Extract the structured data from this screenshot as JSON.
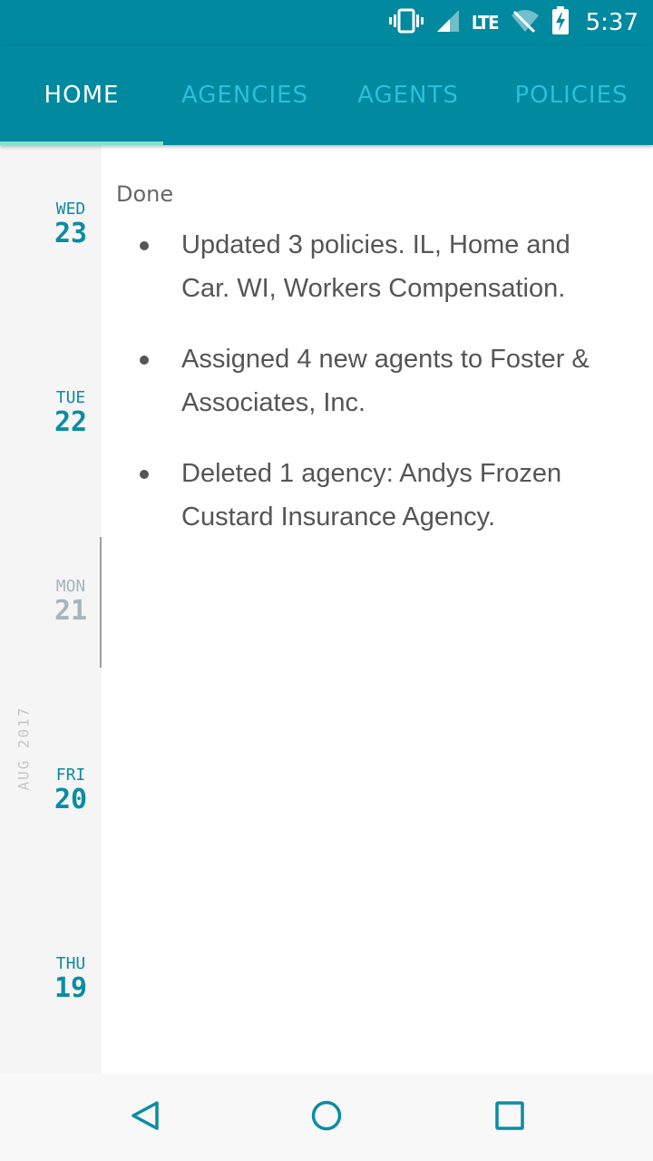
{
  "status_bar": {
    "time": "5:37",
    "network": "LTE",
    "icons": [
      "vibrate-icon",
      "signal-icon",
      "wifi-off-icon",
      "battery-charging-icon"
    ]
  },
  "tabs": [
    {
      "label": "HOME",
      "active": true
    },
    {
      "label": "AGENCIES",
      "active": false
    },
    {
      "label": "AGENTS",
      "active": false
    },
    {
      "label": "POLICIES",
      "active": false
    }
  ],
  "date_rail": {
    "month": "AUG 2017",
    "dates": [
      {
        "dow": "WED",
        "day": "23"
      },
      {
        "dow": "TUE",
        "day": "22"
      },
      {
        "dow": "MON",
        "day": "21"
      },
      {
        "dow": "FRI",
        "day": "20"
      },
      {
        "dow": "THU",
        "day": "19"
      }
    ]
  },
  "content": {
    "section_title": "Done",
    "entries": [
      "Updated 3 policies. IL, Home and Car. WI, Workers Compensation.",
      "Assigned 4 new agents to Foster & Associates, Inc.",
      "Deleted 1 agency: Andys Frozen Custard Insurance Agency."
    ]
  },
  "nav_bar": {
    "buttons": [
      "back-icon",
      "home-icon",
      "recents-icon"
    ]
  },
  "colors": {
    "primary": "#00899f",
    "accent": "#7ee3c9",
    "date_text": "#0b8ca3",
    "inactive_tab": "#29c0dc"
  }
}
